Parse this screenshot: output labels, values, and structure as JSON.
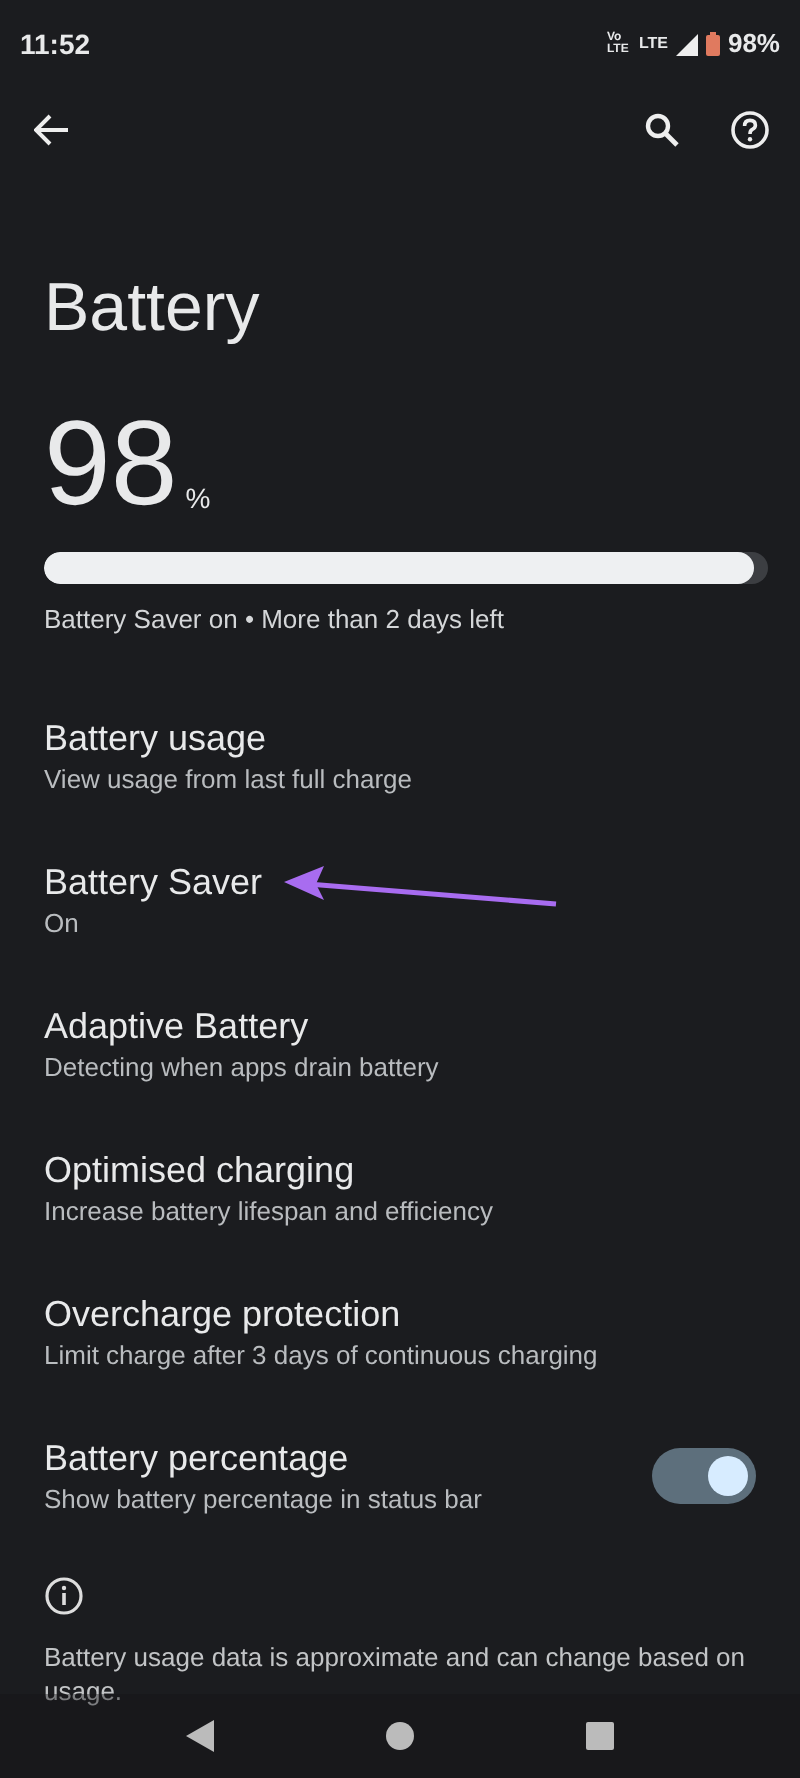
{
  "status_bar": {
    "time": "11:52",
    "network_1": "Vo LTE",
    "network_2": "LTE",
    "battery_text": "98%"
  },
  "title": "Battery",
  "battery": {
    "percent": "98",
    "unit": "%",
    "level": 0.98,
    "summary": "Battery Saver on • More than 2 days left"
  },
  "items": [
    {
      "kind": "text",
      "title": "Battery usage",
      "subtitle": "View usage from last full charge"
    },
    {
      "kind": "text",
      "title": "Battery Saver",
      "subtitle": "On"
    },
    {
      "kind": "text",
      "title": "Adaptive Battery",
      "subtitle": "Detecting when apps drain battery"
    },
    {
      "kind": "text",
      "title": "Optimised charging",
      "subtitle": "Increase battery lifespan and efficiency"
    },
    {
      "kind": "text",
      "title": "Overcharge protection",
      "subtitle": "Limit charge after 3 days of continuous charging"
    },
    {
      "kind": "switch",
      "title": "Battery percentage",
      "subtitle": "Show battery percentage in status bar",
      "on": true
    }
  ],
  "footer": "Battery usage data is approximate and can change based on usage."
}
